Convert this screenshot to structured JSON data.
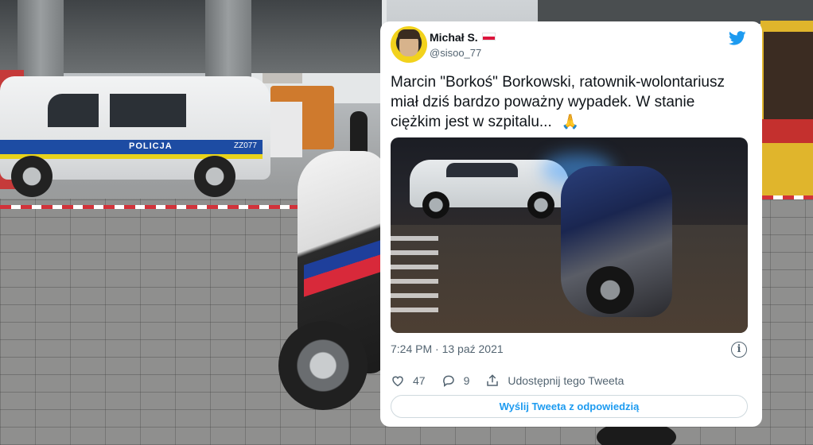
{
  "tweet": {
    "author_name": "Michał S.",
    "author_flag": "flag-poland-icon",
    "author_handle": "@sisoo_77",
    "text": "Marcin \"Borkoś\" Borkowski, ratownik-wolontariusz miał dziś bardzo poważny wypadek. W stanie ciężkim jest w szpitalu...",
    "emoji": "🙏",
    "timestamp": "7:24 PM · 13 paź 2021",
    "likes": "47",
    "replies": "9",
    "share_label": "Udostępnij tego Tweeta",
    "reply_button_label": "Wyślij Tweeta z odpowiedzią"
  },
  "background_photo": {
    "van_text": "POLICJA",
    "van_plate": "ZZ077"
  },
  "colors": {
    "twitter_blue": "#1d9bf0",
    "text_primary": "#0f1419",
    "text_secondary": "#536471"
  },
  "icons": [
    "twitter-bird-icon",
    "info-icon",
    "heart-icon",
    "reply-icon",
    "share-icon",
    "flag-poland-icon"
  ]
}
